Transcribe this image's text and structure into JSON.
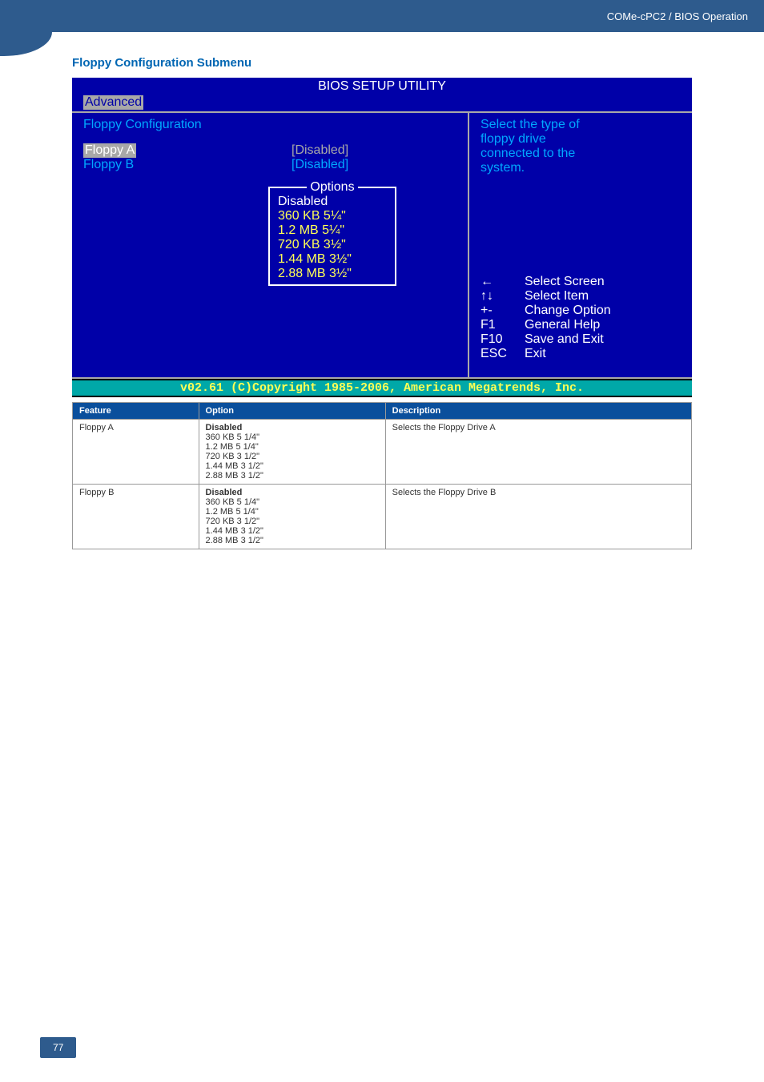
{
  "header": {
    "path": "COMe-cPC2 / BIOS Operation"
  },
  "title": "Floppy Configuration Submenu",
  "bios": {
    "menubar_title": "BIOS SETUP UTILITY",
    "active_tab": "Advanced",
    "panel_title": "Floppy Configuration",
    "rows": [
      {
        "label": "Floppy A",
        "value": "[Disabled]",
        "selected": true
      },
      {
        "label": "Floppy B",
        "value": "[Disabled]",
        "selected": false
      }
    ],
    "popup": {
      "title": "Options",
      "items": [
        "Disabled",
        "360 KB 5¼\"",
        "1.2 MB 5¼\"",
        "720 KB 3½\"",
        "1.44 MB 3½\"",
        "2.88 MB 3½\""
      ]
    },
    "help": [
      "Select the type of",
      "floppy drive",
      "connected to the",
      "system."
    ],
    "nav": [
      {
        "key": "←",
        "text": "Select Screen"
      },
      {
        "key": "↑↓",
        "text": "Select Item"
      },
      {
        "key": "+-",
        "text": "Change Option"
      },
      {
        "key": "F1",
        "text": "General Help"
      },
      {
        "key": "F10",
        "text": "Save and Exit"
      },
      {
        "key": "ESC",
        "text": "Exit"
      }
    ],
    "footer": "v02.61 (C)Copyright 1985-2006, American Megatrends, Inc."
  },
  "table": {
    "headers": [
      "Feature",
      "Option",
      "Description"
    ],
    "rows": [
      {
        "feature": "Floppy A",
        "options": [
          "Disabled",
          "360 KB 5 1/4\"",
          "1.2 MB 5 1/4\"",
          "720 KB 3 1/2\"",
          "1.44 MB 3 1/2\"",
          "2.88 MB 3 1/2\""
        ],
        "description": "Selects the Floppy Drive A"
      },
      {
        "feature": "Floppy B",
        "options": [
          "Disabled",
          "360 KB 5 1/4\"",
          "1.2 MB 5 1/4\"",
          "720 KB 3 1/2\"",
          "1.44 MB 3 1/2\"",
          "2.88 MB 3 1/2\""
        ],
        "description": "Selects the Floppy Drive B"
      }
    ]
  },
  "page_number": "77"
}
